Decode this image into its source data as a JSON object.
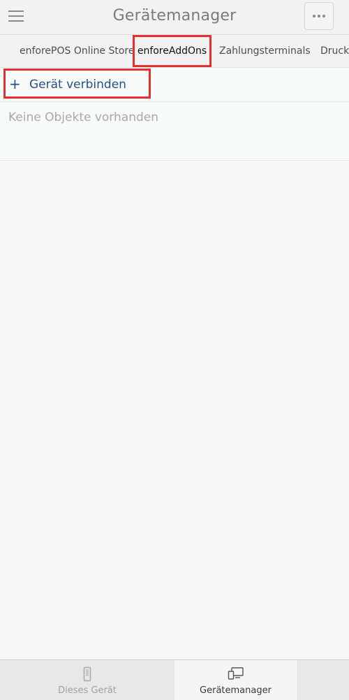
{
  "header": {
    "title": "Gerätemanager",
    "menu_icon": "hamburger-menu-icon",
    "more_icon": "more-dots-icon"
  },
  "tabs": [
    {
      "label": "enforePOS Online Store",
      "selected": false
    },
    {
      "label": "enforeAddOns",
      "selected": true
    },
    {
      "label": "Zahlungsterminals",
      "selected": false
    },
    {
      "label": "Drucke",
      "selected": false
    }
  ],
  "main": {
    "connect_icon": "plus-icon",
    "connect_plus": "+",
    "connect_label": "Gerät verbinden",
    "empty_text": "Keine Objekte vorhanden"
  },
  "bottom_nav": [
    {
      "label": "Dieses Gerät",
      "icon": "phone-icon",
      "active": false
    },
    {
      "label": "Gerätemanager",
      "icon": "devices-icon",
      "active": true
    }
  ],
  "colors": {
    "accent": "#2b4f87",
    "highlight": "#e53030",
    "header_bg": "#f2f2f2",
    "content_bg": "#f6faf8"
  }
}
